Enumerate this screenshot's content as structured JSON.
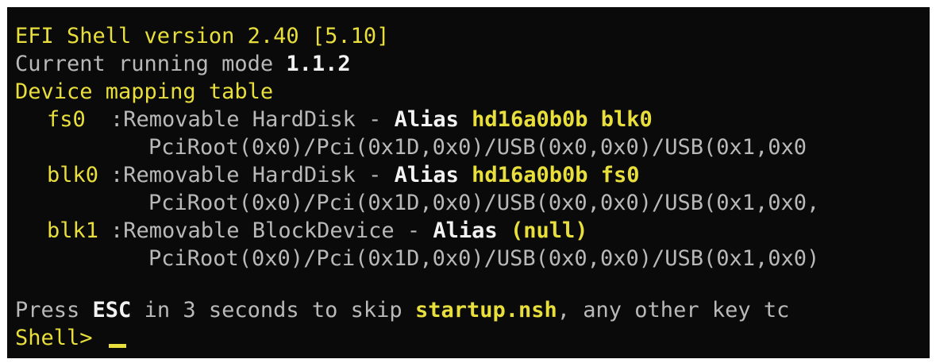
{
  "header": {
    "version_line": "EFI Shell version 2.40 [5.10]",
    "mode_label": "Current running mode ",
    "mode_value": "1.1.2",
    "table_title": "Device mapping table"
  },
  "mappings": [
    {
      "name": "fs0",
      "desc": ":Removable HardDisk - ",
      "alias_label": "Alias",
      "alias_value": "hd16a0b0b blk0",
      "path": "PciRoot(0x0)/Pci(0x1D,0x0)/USB(0x0,0x0)/USB(0x1,0x0"
    },
    {
      "name": "blk0",
      "desc": ":Removable HardDisk - ",
      "alias_label": "Alias",
      "alias_value": "hd16a0b0b fs0",
      "path": "PciRoot(0x0)/Pci(0x1D,0x0)/USB(0x0,0x0)/USB(0x1,0x0,"
    },
    {
      "name": "blk1",
      "desc": ":Removable BlockDevice - ",
      "alias_label": "Alias",
      "alias_value": "(null)",
      "path": "PciRoot(0x0)/Pci(0x1D,0x0)/USB(0x0,0x0)/USB(0x1,0x0)"
    }
  ],
  "startup_prompt": {
    "prefix": "Press ",
    "esc_key": "ESC",
    "middle": " in 3 seconds to skip ",
    "script_name": "startup.nsh",
    "suffix": ", any other key tc"
  },
  "shell_prompt": "Shell> ",
  "colors": {
    "background": "#0a0a0a",
    "yellow": "#e8df3c",
    "gray": "#b9b9b9",
    "white": "#f2f2f2"
  }
}
